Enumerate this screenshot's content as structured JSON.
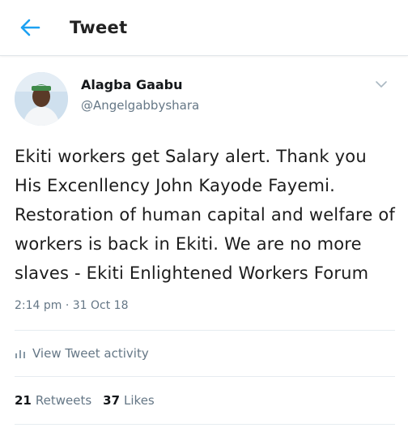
{
  "topbar": {
    "title": "Tweet"
  },
  "author": {
    "name": "Alagba Gaabu",
    "handle": "@Angelgabbyshara"
  },
  "tweet": {
    "text": "Ekiti workers get Salary alert. Thank you His Excenllency John Kayode Fayemi. Restoration of human capital and welfare of workers is back in Ekiti. We are no more slaves - Ekiti Enlightened Workers Forum",
    "timestamp": "2:14 pm · 31 Oct 18"
  },
  "activity": {
    "label": "View Tweet activity"
  },
  "stats": {
    "retweets_count": "21",
    "retweets_label": "Retweets",
    "likes_count": "37",
    "likes_label": "Likes"
  },
  "colors": {
    "accent": "#1da1f2",
    "muted": "#657786"
  },
  "icons": {
    "back": "arrow-left-icon",
    "more": "chevron-down-icon",
    "activity": "bar-chart-icon"
  }
}
